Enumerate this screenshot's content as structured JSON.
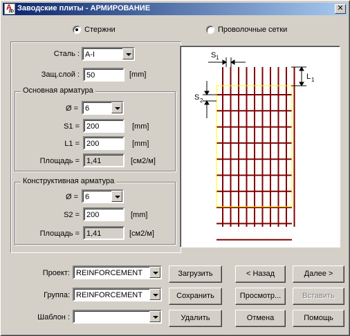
{
  "window": {
    "title": "Заводские плиты - АРМИРОВАНИЕ",
    "icon_letter": "A",
    "icon_sub": "3D",
    "close_label": "✕"
  },
  "mode": {
    "option1": "Стержни",
    "option2": "Проволочные сетки",
    "selected": "option1"
  },
  "left": {
    "steel_label": "Сталь :",
    "steel_value": "A-I",
    "cover_label": "Защ.слой :",
    "cover_value": "50",
    "cover_unit": "[mm]",
    "main": {
      "title": "Основная арматура",
      "dia_label": "Ø  =",
      "dia_value": "6",
      "s1_label": "S1 =",
      "s1_value": "200",
      "s1_unit": "[mm]",
      "l1_label": "L1 =",
      "l1_value": "200",
      "l1_unit": "[mm]",
      "area_label": "Площадь =",
      "area_value": "1,41",
      "area_unit": "[см2/м]"
    },
    "constr": {
      "title": "Конструктивная арматура",
      "dia_label": "Ø  =",
      "dia_value": "6",
      "s2_label": "S2 =",
      "s2_value": "200",
      "s2_unit": "[mm]",
      "area_label": "Площадь =",
      "area_value": "1,41",
      "area_unit": "[см2/м]"
    }
  },
  "drawing": {
    "s1_label": "S",
    "s1_sub": "1",
    "s2_label": "S",
    "s2_sub": "2",
    "l1_label": "L",
    "l1_sub": "1",
    "bar_color": "#800000",
    "outline_color": "#ffff00"
  },
  "bottom": {
    "project_label": "Проект:",
    "project_value": "REINFORCEMENT",
    "group_label": "Группа:",
    "group_value": "REINFORCEMENT",
    "template_label": "Шаблон :",
    "template_value": "",
    "load_button": "Загрузить",
    "save_button": "Сохранить",
    "delete_button": "Удалить",
    "back_button": "< Назад",
    "next_button": "Далее >",
    "preview_button": "Просмотр...",
    "insert_button": "Вставить",
    "cancel_button": "Отмена",
    "help_button": "Помощь"
  }
}
